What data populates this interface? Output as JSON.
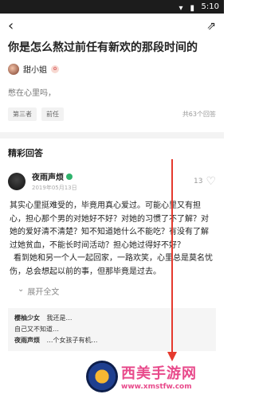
{
  "statusbar": {
    "time": "5:10"
  },
  "header": {
    "back_label": "‹",
    "share_label": "⇗"
  },
  "question": {
    "title": "你是怎么熬过前任有新欢的那段时间的",
    "author_name": "甜小姐",
    "description": "憋在心里吗，",
    "tags": [
      "第三者",
      "前任"
    ],
    "answers_count": "共63个回答"
  },
  "answers_section": {
    "title": "精彩回答"
  },
  "answer": {
    "author_name": "夜雨声烦",
    "date": "2019年05月13日",
    "likes": "13",
    "paragraph1": "其实心里挺难受的，毕竟用真心爱过。可能心里又有担心，担心那个男的对她好不好？对她的习惯了不了解？对她的爱好清不清楚？知不知道她什么不能吃？有没有了解过她贫血，不能长时间活动？担心她过得好不好？",
    "paragraph2": "看到她和另一个人一起回家，一路欢笑，心里总是莫名忧伤，总会想起以前的事，但那毕竟是过去。",
    "expand_label": "展开全文"
  },
  "comments": [
    {
      "user": "樱柚少女",
      "text": "我还是…"
    },
    {
      "user": "",
      "text": "自己又不知道…"
    },
    {
      "user": "夜雨声烦",
      "text": "…个女孩子有机…"
    }
  ],
  "watermark": {
    "text": "西美手游网",
    "url": "www.xmstfw.com"
  },
  "colors": {
    "arrow": "#e53a2e",
    "watermark": "#e84a8b",
    "verified": "#2fb36c"
  }
}
